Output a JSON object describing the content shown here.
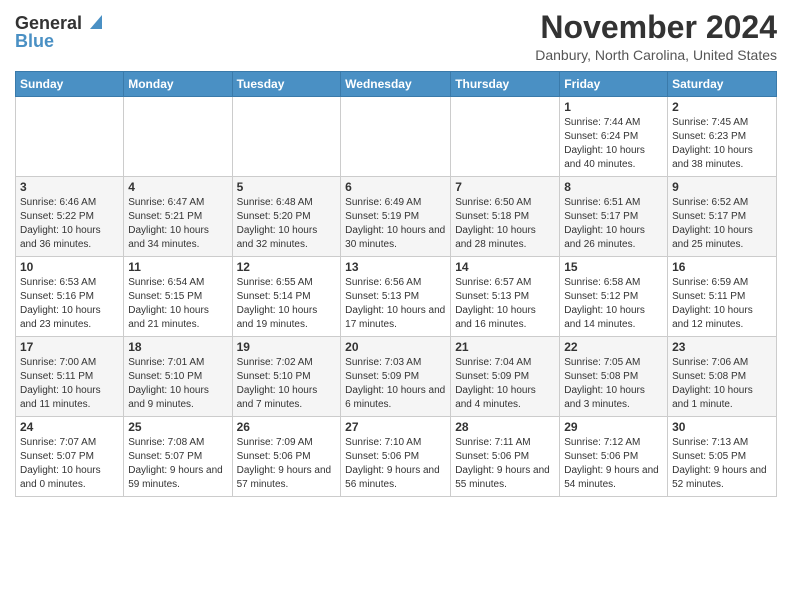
{
  "logo": {
    "general": "General",
    "blue": "Blue"
  },
  "title": "November 2024",
  "location": "Danbury, North Carolina, United States",
  "weekdays": [
    "Sunday",
    "Monday",
    "Tuesday",
    "Wednesday",
    "Thursday",
    "Friday",
    "Saturday"
  ],
  "weeks": [
    [
      {
        "day": "",
        "info": ""
      },
      {
        "day": "",
        "info": ""
      },
      {
        "day": "",
        "info": ""
      },
      {
        "day": "",
        "info": ""
      },
      {
        "day": "",
        "info": ""
      },
      {
        "day": "1",
        "info": "Sunrise: 7:44 AM\nSunset: 6:24 PM\nDaylight: 10 hours and 40 minutes."
      },
      {
        "day": "2",
        "info": "Sunrise: 7:45 AM\nSunset: 6:23 PM\nDaylight: 10 hours and 38 minutes."
      }
    ],
    [
      {
        "day": "3",
        "info": "Sunrise: 6:46 AM\nSunset: 5:22 PM\nDaylight: 10 hours and 36 minutes."
      },
      {
        "day": "4",
        "info": "Sunrise: 6:47 AM\nSunset: 5:21 PM\nDaylight: 10 hours and 34 minutes."
      },
      {
        "day": "5",
        "info": "Sunrise: 6:48 AM\nSunset: 5:20 PM\nDaylight: 10 hours and 32 minutes."
      },
      {
        "day": "6",
        "info": "Sunrise: 6:49 AM\nSunset: 5:19 PM\nDaylight: 10 hours and 30 minutes."
      },
      {
        "day": "7",
        "info": "Sunrise: 6:50 AM\nSunset: 5:18 PM\nDaylight: 10 hours and 28 minutes."
      },
      {
        "day": "8",
        "info": "Sunrise: 6:51 AM\nSunset: 5:17 PM\nDaylight: 10 hours and 26 minutes."
      },
      {
        "day": "9",
        "info": "Sunrise: 6:52 AM\nSunset: 5:17 PM\nDaylight: 10 hours and 25 minutes."
      }
    ],
    [
      {
        "day": "10",
        "info": "Sunrise: 6:53 AM\nSunset: 5:16 PM\nDaylight: 10 hours and 23 minutes."
      },
      {
        "day": "11",
        "info": "Sunrise: 6:54 AM\nSunset: 5:15 PM\nDaylight: 10 hours and 21 minutes."
      },
      {
        "day": "12",
        "info": "Sunrise: 6:55 AM\nSunset: 5:14 PM\nDaylight: 10 hours and 19 minutes."
      },
      {
        "day": "13",
        "info": "Sunrise: 6:56 AM\nSunset: 5:13 PM\nDaylight: 10 hours and 17 minutes."
      },
      {
        "day": "14",
        "info": "Sunrise: 6:57 AM\nSunset: 5:13 PM\nDaylight: 10 hours and 16 minutes."
      },
      {
        "day": "15",
        "info": "Sunrise: 6:58 AM\nSunset: 5:12 PM\nDaylight: 10 hours and 14 minutes."
      },
      {
        "day": "16",
        "info": "Sunrise: 6:59 AM\nSunset: 5:11 PM\nDaylight: 10 hours and 12 minutes."
      }
    ],
    [
      {
        "day": "17",
        "info": "Sunrise: 7:00 AM\nSunset: 5:11 PM\nDaylight: 10 hours and 11 minutes."
      },
      {
        "day": "18",
        "info": "Sunrise: 7:01 AM\nSunset: 5:10 PM\nDaylight: 10 hours and 9 minutes."
      },
      {
        "day": "19",
        "info": "Sunrise: 7:02 AM\nSunset: 5:10 PM\nDaylight: 10 hours and 7 minutes."
      },
      {
        "day": "20",
        "info": "Sunrise: 7:03 AM\nSunset: 5:09 PM\nDaylight: 10 hours and 6 minutes."
      },
      {
        "day": "21",
        "info": "Sunrise: 7:04 AM\nSunset: 5:09 PM\nDaylight: 10 hours and 4 minutes."
      },
      {
        "day": "22",
        "info": "Sunrise: 7:05 AM\nSunset: 5:08 PM\nDaylight: 10 hours and 3 minutes."
      },
      {
        "day": "23",
        "info": "Sunrise: 7:06 AM\nSunset: 5:08 PM\nDaylight: 10 hours and 1 minute."
      }
    ],
    [
      {
        "day": "24",
        "info": "Sunrise: 7:07 AM\nSunset: 5:07 PM\nDaylight: 10 hours and 0 minutes."
      },
      {
        "day": "25",
        "info": "Sunrise: 7:08 AM\nSunset: 5:07 PM\nDaylight: 9 hours and 59 minutes."
      },
      {
        "day": "26",
        "info": "Sunrise: 7:09 AM\nSunset: 5:06 PM\nDaylight: 9 hours and 57 minutes."
      },
      {
        "day": "27",
        "info": "Sunrise: 7:10 AM\nSunset: 5:06 PM\nDaylight: 9 hours and 56 minutes."
      },
      {
        "day": "28",
        "info": "Sunrise: 7:11 AM\nSunset: 5:06 PM\nDaylight: 9 hours and 55 minutes."
      },
      {
        "day": "29",
        "info": "Sunrise: 7:12 AM\nSunset: 5:06 PM\nDaylight: 9 hours and 54 minutes."
      },
      {
        "day": "30",
        "info": "Sunrise: 7:13 AM\nSunset: 5:05 PM\nDaylight: 9 hours and 52 minutes."
      }
    ]
  ]
}
